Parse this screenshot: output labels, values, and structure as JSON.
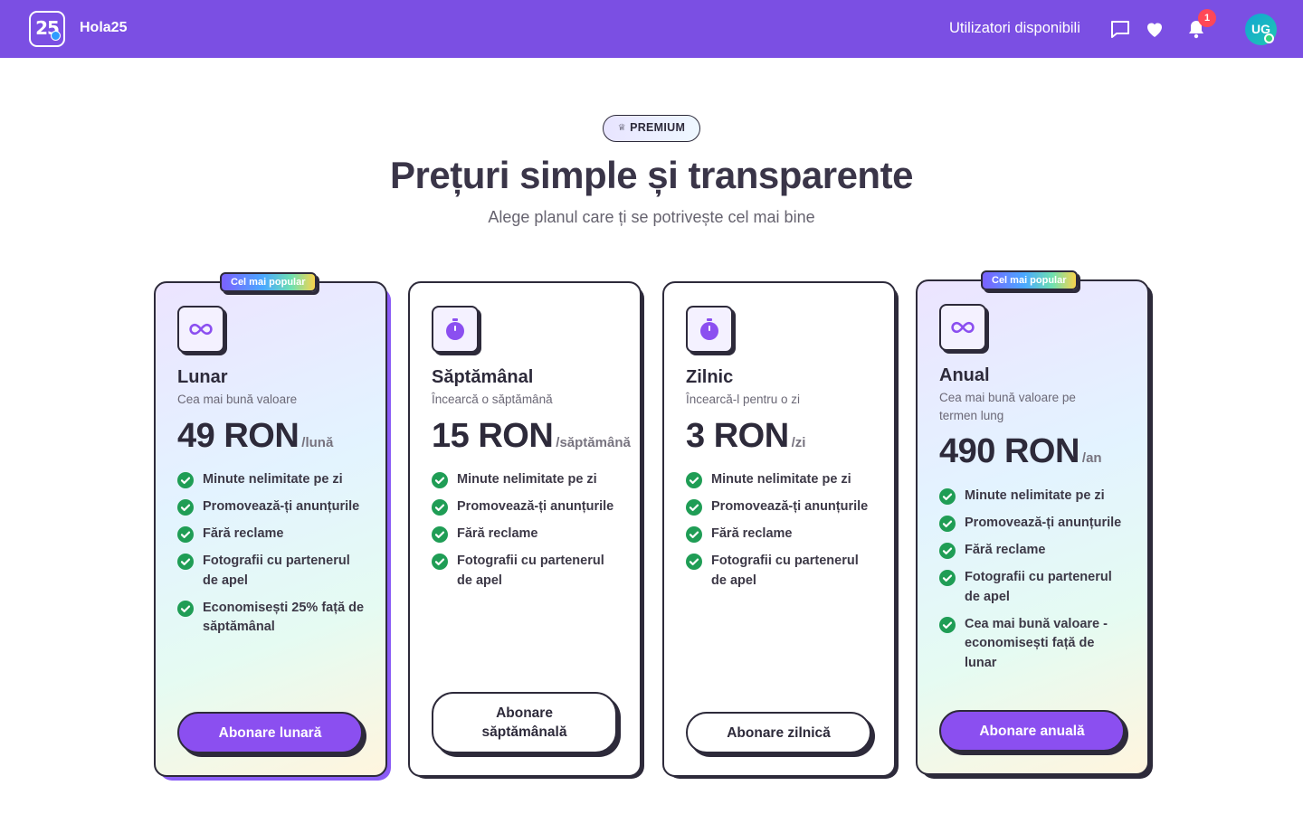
{
  "header": {
    "logo_text": "25",
    "brand": "Hola25",
    "nav_link": "Utilizatori disponibili",
    "notifications_count": "1",
    "avatar_initials": "UG"
  },
  "hero": {
    "badge": "PREMIUM",
    "title": "Prețuri simple și transparente",
    "subtitle": "Alege planul care ți se potrivește cel mai bine"
  },
  "plans": [
    {
      "badge": "Cel mai popular",
      "icon": "infinity-icon",
      "name": "Lunar",
      "description": "Cea mai bună valoare",
      "price": "49 RON",
      "period": "/lună",
      "features": [
        "Minute nelimitate pe zi",
        "Promovează-ți anunțurile",
        "Fără reclame",
        "Fotografii cu partenerul de apel",
        "Economisești 25% față de săptămânal"
      ],
      "button": "Abonare lunară"
    },
    {
      "icon": "stopwatch-icon",
      "name": "Săptămânal",
      "description": "Încearcă o săptămână",
      "price": "15 RON",
      "period": "/săptămână",
      "features": [
        "Minute nelimitate pe zi",
        "Promovează-ți anunțurile",
        "Fără reclame",
        "Fotografii cu partenerul de apel"
      ],
      "button": "Abonare săptămânală"
    },
    {
      "icon": "stopwatch-icon",
      "name": "Zilnic",
      "description": "Încearcă-l pentru o zi",
      "price": "3 RON",
      "period": "/zi",
      "features": [
        "Minute nelimitate pe zi",
        "Promovează-ți anunțurile",
        "Fără reclame",
        "Fotografii cu partenerul de apel"
      ],
      "button": "Abonare zilnică"
    },
    {
      "badge": "Cel mai popular",
      "icon": "infinity-icon",
      "name": "Anual",
      "description": "Cea mai bună valoare pe termen lung",
      "price": "490 RON",
      "period": "/an",
      "features": [
        "Minute nelimitate pe zi",
        "Promovează-ți anunțurile",
        "Fără reclame",
        "Fotografii cu partenerul de apel",
        "Cea mai bună valoare - economisești față de lunar"
      ],
      "button": "Abonare anuală"
    }
  ],
  "colors": {
    "header_bg": "#7b4fe3",
    "accent": "#8b4ff0",
    "check": "#1f9d55",
    "ink": "#2d2a3a",
    "badge": "#ff4757"
  }
}
